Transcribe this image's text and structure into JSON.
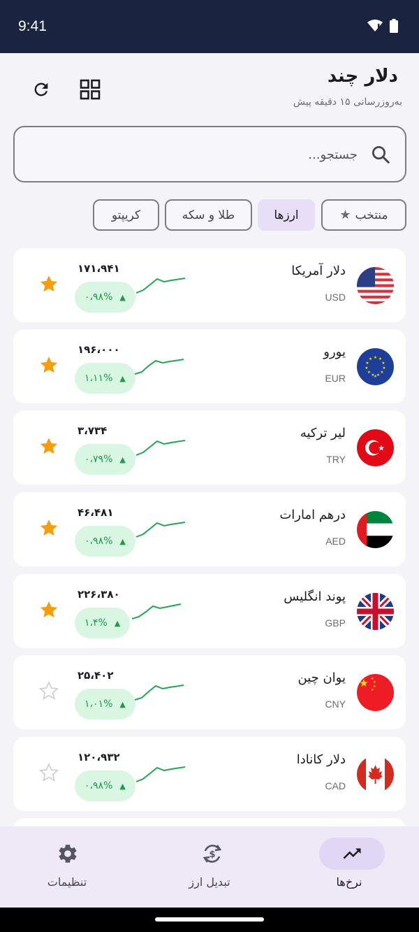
{
  "status_bar": {
    "time": "9:41"
  },
  "header": {
    "title": "دلار چند",
    "subtitle": "به‌روزرسانی ۱۵ دقیقه پیش"
  },
  "search": {
    "placeholder": "جستجو..."
  },
  "filters": [
    {
      "label": "منتخب",
      "icon": "star-icon",
      "selected": false
    },
    {
      "label": "ارزها",
      "selected": true
    },
    {
      "label": "طلا و سکه",
      "selected": false
    },
    {
      "label": "کریپتو",
      "selected": false
    }
  ],
  "currencies": [
    {
      "name": "دلار آمریکا",
      "code": "USD",
      "price": "۱۷۱،۹۴۱",
      "change": "۰،۹۸%",
      "trend": "up",
      "favorite": true,
      "flag": "us-flag"
    },
    {
      "name": "یورو",
      "code": "EUR",
      "price": "۱۹۶،۰۰۰",
      "change": "۱،۱۱%",
      "trend": "up",
      "favorite": true,
      "flag": "eu-flag"
    },
    {
      "name": "لیر ترکیه",
      "code": "TRY",
      "price": "۳،۷۳۴",
      "change": "۰،۷۹%",
      "trend": "up",
      "favorite": true,
      "flag": "tr-flag"
    },
    {
      "name": "درهم امارات",
      "code": "AED",
      "price": "۴۶،۴۸۱",
      "change": "۰،۹۸%",
      "trend": "up",
      "favorite": true,
      "flag": "ae-flag"
    },
    {
      "name": "پوند انگلیس",
      "code": "GBP",
      "price": "۲۲۶،۳۸۰",
      "change": "۱،۴%",
      "trend": "up",
      "favorite": true,
      "flag": "gb-flag"
    },
    {
      "name": "یوان چین",
      "code": "CNY",
      "price": "۲۵،۴۰۲",
      "change": "۱،۰۱%",
      "trend": "up",
      "favorite": false,
      "flag": "cn-flag"
    },
    {
      "name": "دلار کانادا",
      "code": "CAD",
      "price": "۱۲۰،۹۳۲",
      "change": "۰،۹۸%",
      "trend": "up",
      "favorite": false,
      "flag": "ca-flag"
    }
  ],
  "bottom_nav": [
    {
      "label": "نرخ‌ها",
      "icon": "trending-up-icon",
      "active": true
    },
    {
      "label": "تبدیل ارز",
      "icon": "currency-exchange-icon",
      "active": false
    },
    {
      "label": "تنظیمات",
      "icon": "gear-icon",
      "active": false
    }
  ],
  "colors": {
    "status_bar": "#1a2340",
    "accent_chip": "#e8def8",
    "positive_green": "#1a9c4b",
    "positive_bg": "#d9f6e2",
    "favorite_star": "#f59e0b",
    "nav_bg": "#efe8f6"
  }
}
